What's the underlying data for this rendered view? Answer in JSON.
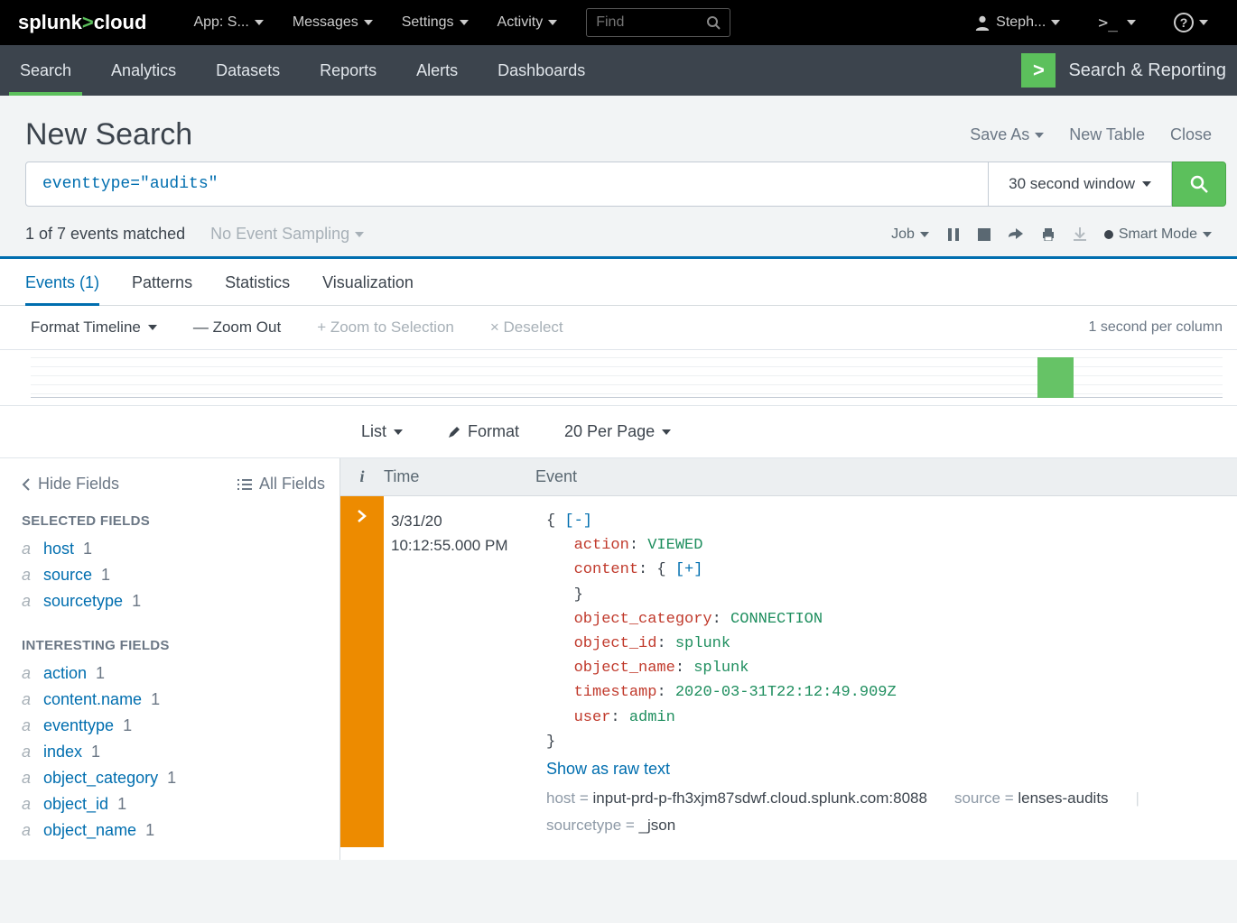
{
  "topbar": {
    "logo_left": "splunk",
    "logo_right": "cloud",
    "menu": [
      "App: S...",
      "Messages",
      "Settings",
      "Activity"
    ],
    "find_placeholder": "Find",
    "user": "Steph..."
  },
  "secbar": {
    "tabs": [
      "Search",
      "Analytics",
      "Datasets",
      "Reports",
      "Alerts",
      "Dashboards"
    ],
    "active": 0,
    "brand": "Search & Reporting"
  },
  "page": {
    "title": "New Search",
    "actions": {
      "save_as": "Save As",
      "new_table": "New Table",
      "close": "Close"
    }
  },
  "search": {
    "query": "eventtype=\"audits\"",
    "time_label": "30 second window"
  },
  "status": {
    "summary": "1 of 7 events matched",
    "sampling": "No Event Sampling",
    "job_label": "Job",
    "mode": "Smart Mode"
  },
  "tabs": {
    "items": [
      "Events (1)",
      "Patterns",
      "Statistics",
      "Visualization"
    ],
    "active": 0
  },
  "timeline": {
    "format": "Format Timeline",
    "zoom_out": "— Zoom Out",
    "zoom_sel": "+ Zoom to Selection",
    "deselect": "× Deselect",
    "per_col": "1 second per column"
  },
  "listctrls": {
    "list": "List",
    "format": "Format",
    "perpage": "20 Per Page"
  },
  "sidebar": {
    "hide": "Hide Fields",
    "all": "All Fields",
    "selected_hdr": "SELECTED FIELDS",
    "selected": [
      {
        "type": "a",
        "name": "host",
        "count": "1"
      },
      {
        "type": "a",
        "name": "source",
        "count": "1"
      },
      {
        "type": "a",
        "name": "sourcetype",
        "count": "1"
      }
    ],
    "interesting_hdr": "INTERESTING FIELDS",
    "interesting": [
      {
        "type": "a",
        "name": "action",
        "count": "1"
      },
      {
        "type": "a",
        "name": "content.name",
        "count": "1"
      },
      {
        "type": "a",
        "name": "eventtype",
        "count": "1"
      },
      {
        "type": "a",
        "name": "index",
        "count": "1"
      },
      {
        "type": "a",
        "name": "object_category",
        "count": "1"
      },
      {
        "type": "a",
        "name": "object_id",
        "count": "1"
      },
      {
        "type": "a",
        "name": "object_name",
        "count": "1"
      }
    ]
  },
  "evhdr": {
    "i": "i",
    "time": "Time",
    "event": "Event"
  },
  "event": {
    "date": "3/31/20",
    "time": "10:12:55.000 PM",
    "json": {
      "action": "VIEWED",
      "content_collapsed": "[+]",
      "object_category": "CONNECTION",
      "object_id": "splunk",
      "object_name": "splunk",
      "timestamp": "2020-03-31T22:12:49.909Z",
      "user": "admin"
    },
    "raw_link": "Show as raw text",
    "meta": {
      "host": "input-prd-p-fh3xjm87sdwf.cloud.splunk.com:8088",
      "source": "lenses-audits",
      "sourcetype": "_json"
    },
    "meta_labels": {
      "host": "host =",
      "source": "source =",
      "sourcetype": "sourcetype ="
    }
  }
}
